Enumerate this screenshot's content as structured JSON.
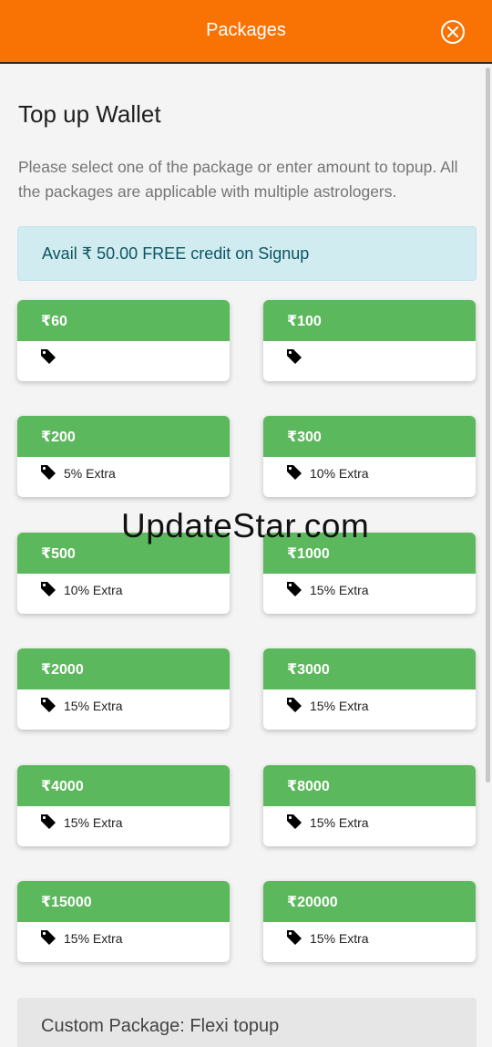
{
  "header": {
    "title": "Packages",
    "close_icon": "close-circle-icon"
  },
  "main": {
    "title": "Top up Wallet",
    "description": "Please select one of the package or enter amount to topup. All the packages are applicable with multiple astrologers.",
    "promo": "Avail ₹ 50.00 FREE credit on Signup"
  },
  "packages": [
    {
      "price": "₹60",
      "extra": ""
    },
    {
      "price": "₹100",
      "extra": ""
    },
    {
      "price": "₹200",
      "extra": "5% Extra"
    },
    {
      "price": "₹300",
      "extra": "10% Extra"
    },
    {
      "price": "₹500",
      "extra": "10% Extra"
    },
    {
      "price": "₹1000",
      "extra": "15% Extra"
    },
    {
      "price": "₹2000",
      "extra": "15% Extra"
    },
    {
      "price": "₹3000",
      "extra": "15% Extra"
    },
    {
      "price": "₹4000",
      "extra": "15% Extra"
    },
    {
      "price": "₹8000",
      "extra": "15% Extra"
    },
    {
      "price": "₹15000",
      "extra": "15% Extra"
    },
    {
      "price": "₹20000",
      "extra": "15% Extra"
    }
  ],
  "custom": {
    "label": "Custom Package: Flexi topup"
  },
  "watermark": "UpdateStar.com",
  "colors": {
    "header": "#f97304",
    "package_header": "#5cb85c",
    "promo_bg": "#d1ecf1",
    "promo_text": "#0c5460"
  },
  "icons": {
    "package_icon": "tag-icon"
  }
}
